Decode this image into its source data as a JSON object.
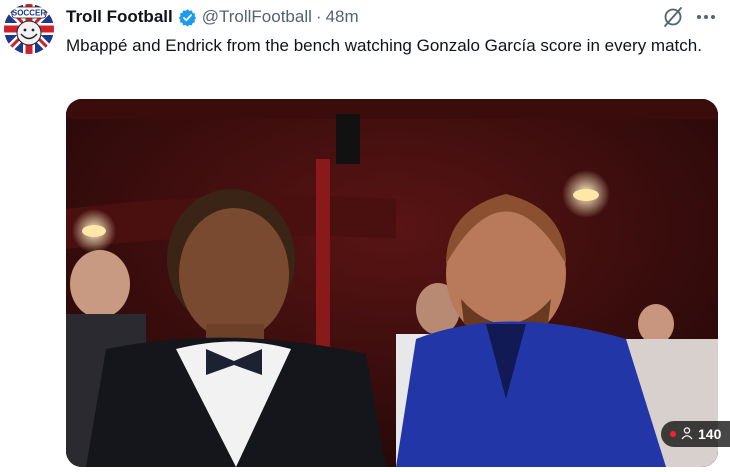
{
  "tweet": {
    "display_name": "Troll Football",
    "handle": "@TrollFootball",
    "separator": "·",
    "time": "48m",
    "text": "Mbappé and Endrick from the bench watching Gonzalo García score in every match."
  },
  "avatar": {
    "text": "SOCCER"
  },
  "icons": {
    "verified": "verified-badge-icon",
    "grok": "grok-icon",
    "more": "more-icon",
    "views": "person-icon"
  },
  "media": {
    "views_count": "140"
  },
  "colors": {
    "verified": "#1d9bf0",
    "secondary_text": "#536471",
    "live": "#f4212e"
  }
}
